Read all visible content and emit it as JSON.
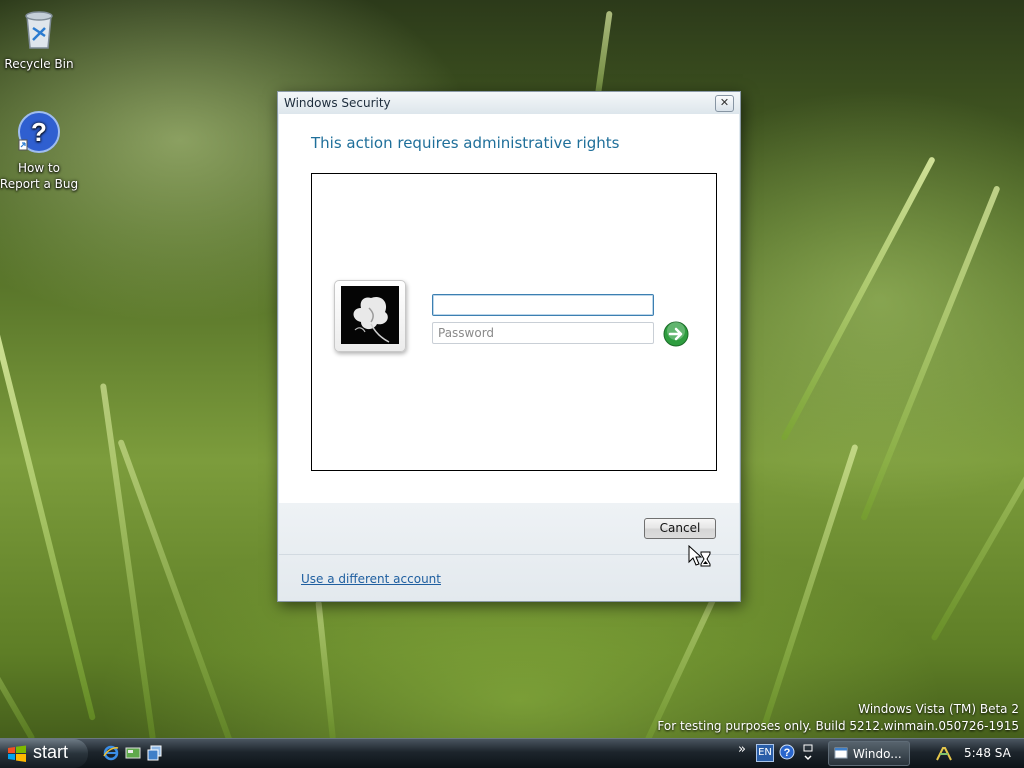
{
  "desktop": {
    "icons": [
      {
        "label": "Recycle Bin",
        "icon": "recycle-bin-icon"
      },
      {
        "label": "How to Report a Bug",
        "icon": "help-question-icon"
      }
    ]
  },
  "dialog": {
    "title": "Windows Security",
    "close_glyph": "✕",
    "heading": "This action requires administrative rights",
    "username": {
      "value": "",
      "placeholder": ""
    },
    "password": {
      "value": "",
      "placeholder": "Password"
    },
    "submit_icon": "arrow-right-icon",
    "cancel_label": "Cancel",
    "alt_account_link": "Use a different account"
  },
  "watermark": {
    "line1": "Windows Vista (TM) Beta 2",
    "line2": "For testing purposes only. Build 5212.winmain.050726-1915"
  },
  "taskbar": {
    "start_label": "start",
    "quick_launch": [
      "internet-explorer-icon",
      "show-desktop-icon",
      "switch-windows-icon"
    ],
    "tray": {
      "expand_glyph": "»",
      "language": "EN",
      "task_label": "Windo...",
      "clock": "5:48 SA"
    }
  },
  "colors": {
    "heading": "#1f6f9a",
    "link": "#1f5fa0",
    "go_button": "#2e9d3f"
  }
}
